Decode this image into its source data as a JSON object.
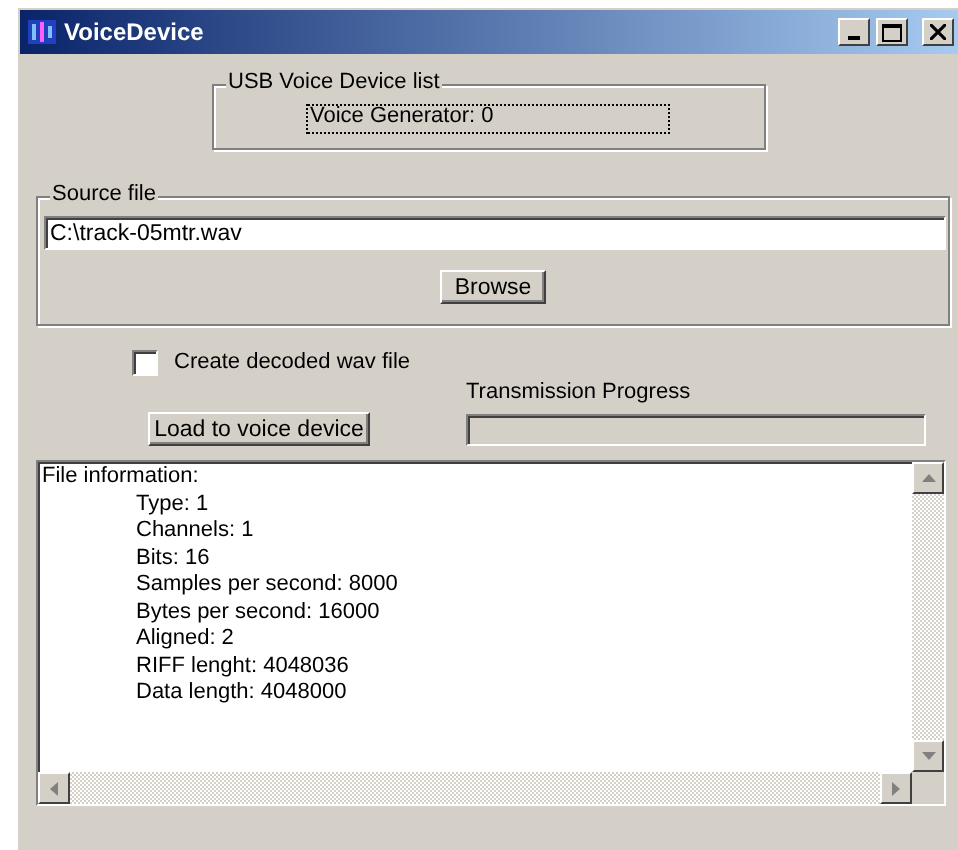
{
  "window": {
    "title": "VoiceDevice"
  },
  "usb_group": {
    "legend": "USB Voice Device list",
    "items": [
      {
        "label": "Voice Generator: 0",
        "selected": true
      }
    ]
  },
  "source_group": {
    "legend": "Source file",
    "file_path": "C:\\track-05mtr.wav",
    "browse_button": "Browse"
  },
  "decode_checkbox": {
    "label": "Create decoded wav file",
    "checked": false
  },
  "load_button": "Load to voice device",
  "progress": {
    "label": "Transmission Progress",
    "level": 0
  },
  "file_info": {
    "heading": "File information:",
    "lines": [
      "Type: 1",
      "Channels: 1",
      "Bits: 16",
      "Samples per second: 8000",
      "Bytes per second: 16000",
      "Aligned: 2",
      "RIFF lenght: 4048036",
      "Data length: 4048000"
    ]
  }
}
